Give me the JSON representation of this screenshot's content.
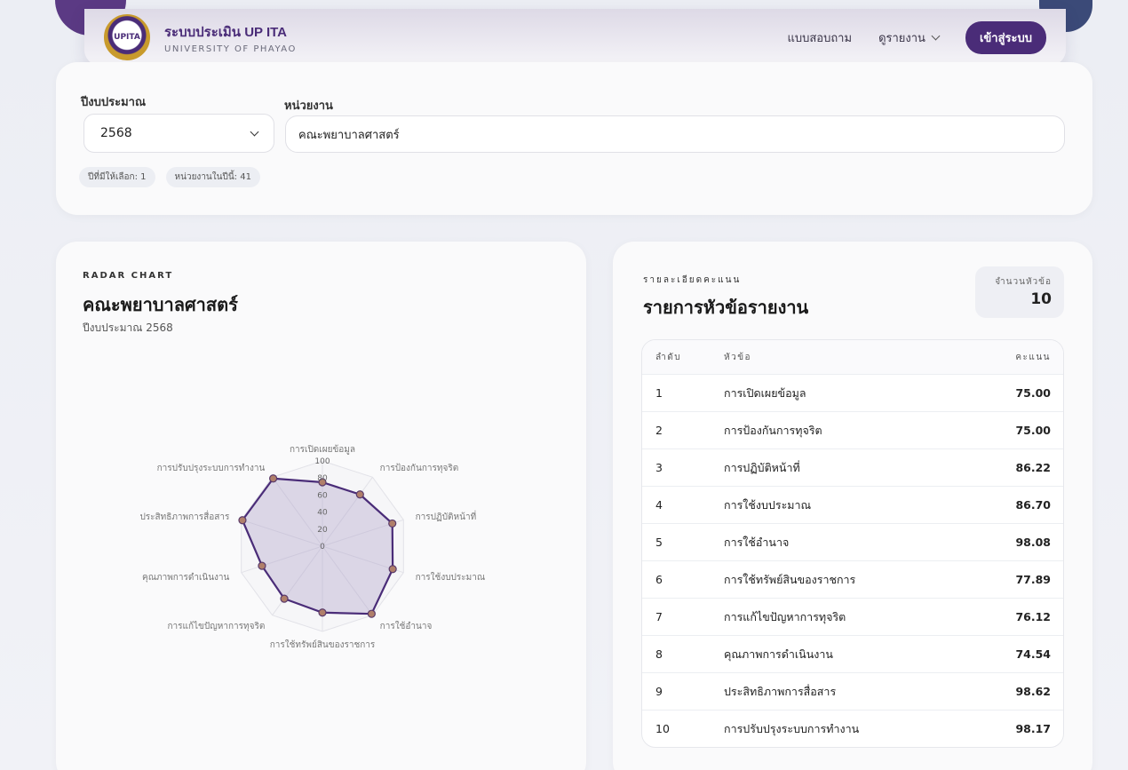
{
  "header": {
    "logo_text": "UPITA",
    "title": "ระบบประเมิน UP ITA",
    "subtitle": "UNIVERSITY OF PHAYAO",
    "nav_survey": "แบบสอบถาม",
    "nav_report": "ดูรายงาน",
    "login_label": "เข้าสู่ระบบ"
  },
  "filters": {
    "year_label": "ปีงบประมาณ",
    "year_value": "2568",
    "dept_label": "หน่วยงาน",
    "dept_value": "คณะพยาบาลศาสตร์",
    "chip_years": "ปีที่มีให้เลือก: 1",
    "chip_units": "หน่วยงานในปีนี้: 41"
  },
  "radar": {
    "kicker": "RADAR CHART",
    "title": "คณะพยาบาลศาสตร์",
    "subtitle": "ปีงบประมาณ 2568"
  },
  "chart_data": {
    "type": "radar",
    "categories": [
      "การเปิดเผยข้อมูล",
      "การป้องกันการทุจริต",
      "การปฏิบัติหน้าที่",
      "การใช้งบประมาณ",
      "การใช้อำนาจ",
      "การใช้ทรัพย์สินของราชการ",
      "การแก้ไขปัญหาการทุจริต",
      "คุณภาพการดำเนินงาน",
      "ประสิทธิภาพการสื่อสาร",
      "การปรับปรุงระบบการทำงาน"
    ],
    "values": [
      75.0,
      75.0,
      86.22,
      86.7,
      98.08,
      77.89,
      76.12,
      74.54,
      98.62,
      98.17
    ],
    "rlim": [
      0,
      100
    ],
    "ticks": [
      "0",
      "20",
      "40",
      "60",
      "80",
      "100"
    ],
    "colors": {
      "line": "#4a2c78",
      "fill": "#a99ac7",
      "point": "#b07f6a"
    }
  },
  "details": {
    "kicker": "รายละเอียดคะแนน",
    "title": "รายการหัวข้อรายงาน",
    "count_label": "จำนวนหัวข้อ",
    "count_value": "10",
    "columns": [
      "ลำดับ",
      "หัวข้อ",
      "คะแนน"
    ],
    "rows": [
      {
        "no": "1",
        "topic": "การเปิดเผยข้อมูล",
        "score": "75.00"
      },
      {
        "no": "2",
        "topic": "การป้องกันการทุจริต",
        "score": "75.00"
      },
      {
        "no": "3",
        "topic": "การปฏิบัติหน้าที่",
        "score": "86.22"
      },
      {
        "no": "4",
        "topic": "การใช้งบประมาณ",
        "score": "86.70"
      },
      {
        "no": "5",
        "topic": "การใช้อำนาจ",
        "score": "98.08"
      },
      {
        "no": "6",
        "topic": "การใช้ทรัพย์สินของราชการ",
        "score": "77.89"
      },
      {
        "no": "7",
        "topic": "การแก้ไขปัญหาการทุจริต",
        "score": "76.12"
      },
      {
        "no": "8",
        "topic": "คุณภาพการดำเนินงาน",
        "score": "74.54"
      },
      {
        "no": "9",
        "topic": "ประสิทธิภาพการสื่อสาร",
        "score": "98.62"
      },
      {
        "no": "10",
        "topic": "การปรับปรุงระบบการทำงาน",
        "score": "98.17"
      }
    ]
  }
}
